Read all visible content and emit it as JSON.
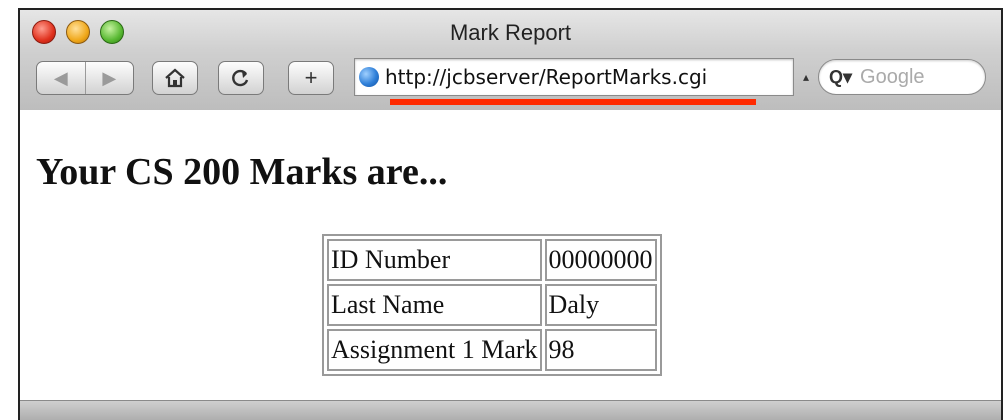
{
  "window": {
    "title": "Mark Report"
  },
  "toolbar": {
    "back_icon": "back-arrow-icon",
    "forward_icon": "forward-arrow-icon",
    "home_icon": "house-icon",
    "reload_icon": "reload-icon",
    "add_icon": "plus-icon"
  },
  "address": {
    "url": "http://jcbserver/ReportMarks.cgi",
    "highlight_color": "#ff2a00"
  },
  "search": {
    "placeholder": "Google"
  },
  "page": {
    "heading": "Your CS 200 Marks are..."
  },
  "marks_table": [
    {
      "label": "ID Number",
      "value": "00000000"
    },
    {
      "label": "Last Name",
      "value": "Daly"
    },
    {
      "label": "Assignment 1 Mark",
      "value": "98"
    }
  ]
}
